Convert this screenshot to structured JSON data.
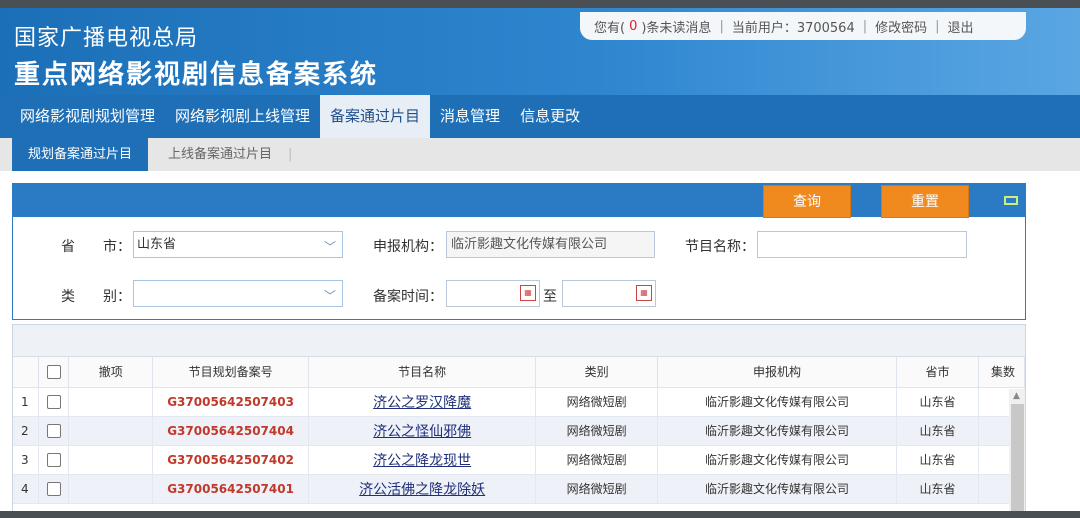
{
  "header": {
    "title_line1": "国家广播电视总局",
    "title_line2": "重点网络影视剧信息备案系统"
  },
  "userbar": {
    "unread_prefix": "您有(",
    "unread_count": "0",
    "unread_suffix": ")条未读消息",
    "current_user": "当前用户：3700564",
    "change_password": "修改密码",
    "logout": "退出"
  },
  "nav": {
    "items": [
      "网络影视剧规划管理",
      "网络影视剧上线管理",
      "备案通过片目",
      "消息管理",
      "信息更改"
    ],
    "active_index": 2
  },
  "subnav": {
    "items": [
      "规划备案通过片目",
      "上线备案通过片目"
    ],
    "divider": "|"
  },
  "search": {
    "query_button": "查询",
    "reset_button": "重置",
    "province_label": "省　　市：",
    "province_value": "山东省",
    "org_label": "申报机构：",
    "org_value": "临沂影趣文化传媒有限公司",
    "program_label": "节目名称：",
    "program_value": "",
    "category_label": "类　　别：",
    "category_value": "",
    "date_label": "备案时间：",
    "date_to": "至"
  },
  "table": {
    "columns": [
      "撤项",
      "节目规划备案号",
      "节目名称",
      "类别",
      "申报机构",
      "省市",
      "集数"
    ],
    "rows": [
      {
        "num": "1",
        "code": "G37005642507403",
        "name": "济公之罗汉降魔",
        "category": "网络微短剧",
        "org": "临沂影趣文化传媒有限公司",
        "province": "山东省"
      },
      {
        "num": "2",
        "code": "G37005642507404",
        "name": "济公之怪仙邪佛",
        "category": "网络微短剧",
        "org": "临沂影趣文化传媒有限公司",
        "province": "山东省"
      },
      {
        "num": "3",
        "code": "G37005642507402",
        "name": "济公之降龙现世",
        "category": "网络微短剧",
        "org": "临沂影趣文化传媒有限公司",
        "province": "山东省"
      },
      {
        "num": "4",
        "code": "G37005642507401",
        "name": "济公活佛之降龙除妖",
        "category": "网络微短剧",
        "org": "临沂影趣文化传媒有限公司",
        "province": "山东省"
      }
    ]
  },
  "colors": {
    "header_blue": "#1b6fb7",
    "nav_blue": "#1f6fb7",
    "button_orange": "#f0891e",
    "code_red": "#c0392b"
  }
}
